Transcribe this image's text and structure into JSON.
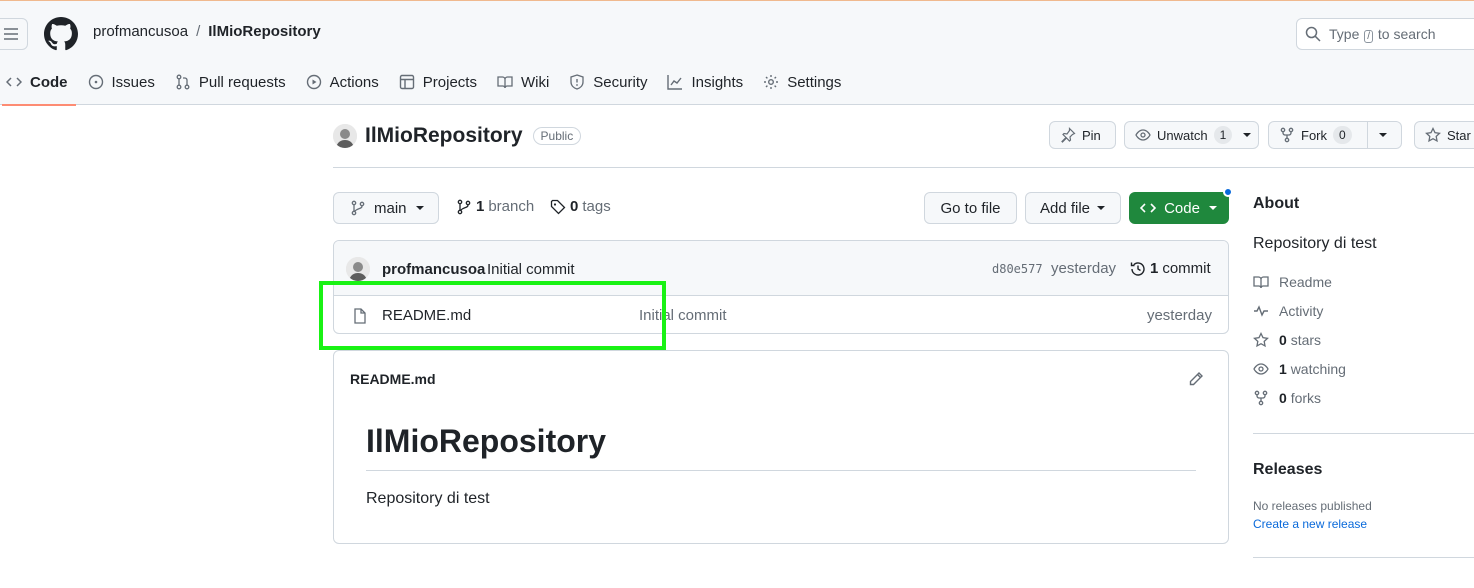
{
  "header": {
    "owner": "profmancusoa",
    "separator": "/",
    "repo": "IlMioRepository",
    "search": {
      "prefix": "Type",
      "key": "/",
      "suffix": "to search"
    }
  },
  "nav": {
    "tabs": [
      {
        "label": "Code",
        "icon": "code-icon",
        "active": true
      },
      {
        "label": "Issues",
        "icon": "issue-icon"
      },
      {
        "label": "Pull requests",
        "icon": "pull-request-icon"
      },
      {
        "label": "Actions",
        "icon": "play-icon"
      },
      {
        "label": "Projects",
        "icon": "table-icon"
      },
      {
        "label": "Wiki",
        "icon": "book-icon"
      },
      {
        "label": "Security",
        "icon": "shield-icon"
      },
      {
        "label": "Insights",
        "icon": "graph-icon"
      },
      {
        "label": "Settings",
        "icon": "gear-icon"
      }
    ]
  },
  "repo_header": {
    "name": "IlMioRepository",
    "visibility": "Public",
    "pin_label": "Pin",
    "unwatch_label": "Unwatch",
    "watch_count": "1",
    "fork_label": "Fork",
    "fork_count": "0",
    "star_label": "Star"
  },
  "branch_bar": {
    "branch": "main",
    "branch_count": "1",
    "branch_label": "branch",
    "tag_count": "0",
    "tag_label": "tags",
    "goto_file": "Go to file",
    "add_file": "Add file",
    "code": "Code"
  },
  "latest_commit": {
    "author": "profmancusoa",
    "message": "Initial commit",
    "sha": "d80e577",
    "time": "yesterday",
    "count": "1",
    "count_label": "commit"
  },
  "files": [
    {
      "name": "README.md",
      "commit_message": "Initial commit",
      "time": "yesterday"
    }
  ],
  "readme": {
    "label": "README.md",
    "heading": "IlMioRepository",
    "body": "Repository di test"
  },
  "sidebar": {
    "about_title": "About",
    "description": "Repository di test",
    "readme_label": "Readme",
    "activity_label": "Activity",
    "stars_count": "0",
    "stars_label": "stars",
    "watching_count": "1",
    "watching_label": "watching",
    "forks_count": "0",
    "forks_label": "forks",
    "releases_title": "Releases",
    "no_releases": "No releases published",
    "create_release": "Create a new release"
  },
  "colors": {
    "accent_green": "#1f883d",
    "link_blue": "#0969da",
    "active_tab_underline": "#fd8c73",
    "highlight_box": "#19f214"
  }
}
